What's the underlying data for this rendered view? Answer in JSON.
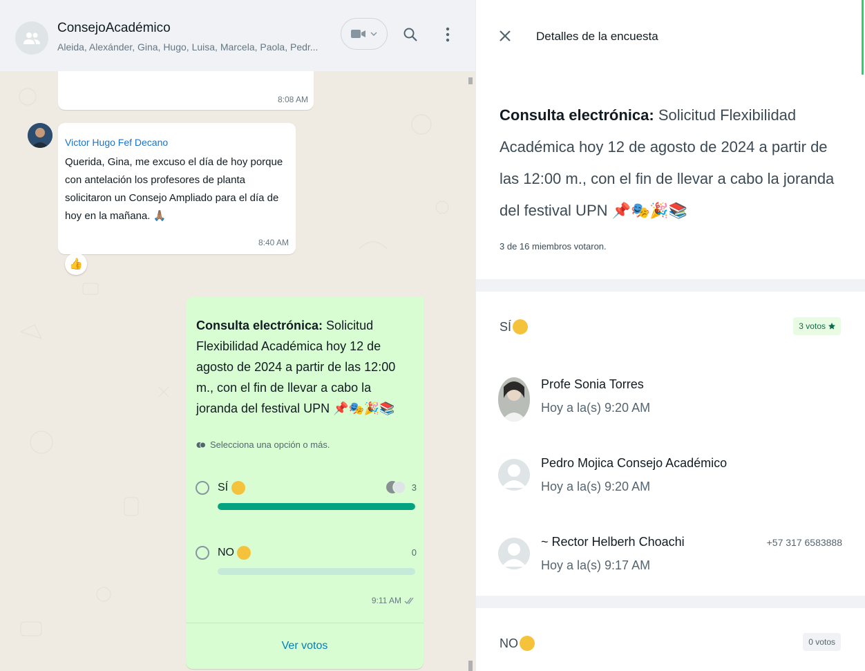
{
  "chat": {
    "header": {
      "group_name": "ConsejoAcadémico",
      "members": "Aleida, Alexánder, Gina, Hugo, Luisa, Marcela, Paola, Pedr..."
    },
    "prev_message": {
      "time": "8:08 AM"
    },
    "message": {
      "sender": "Victor Hugo Fef Decano",
      "text": "Querida, Gina, me excuso el día de hoy porque con antelación los profesores de planta solicitaron un Consejo Ampliado para el día de hoy en la mañana. 🙏🏽",
      "time": "8:40 AM",
      "reaction": "👍"
    },
    "poll": {
      "question_bold": "Consulta electrónica:",
      "question_rest": " Solicitud Flexibilidad Académica hoy 12 de agosto de 2024 a partir de las 12:00 m., con el fin de llevar a cabo la joranda del festival UPN 📌🎭🎉📚",
      "hint": "Selecciona una opción o más.",
      "options": [
        {
          "label": "SÍ",
          "count": "3",
          "fill": 1.0
        },
        {
          "label": "NO",
          "count": "0",
          "fill": 0.0
        }
      ],
      "time": "9:11 AM",
      "view_votes": "Ver votos"
    }
  },
  "details": {
    "title": "Detalles de la encuesta",
    "question_bold": "Consulta electrónica:",
    "question_rest": " Solicitud Flexibilidad Académica hoy 12 de agosto de 2024 a partir de las 12:00 m., con el fin de llevar a cabo la joranda del festival UPN 📌🎭🎉📚",
    "votes_summary": "3 de 16 miembros votaron.",
    "options": [
      {
        "label": "SÍ",
        "chip": "3 votos",
        "voters": [
          {
            "name": "Profe Sonia Torres",
            "time": "Hoy a la(s) 9:20 AM",
            "phone": ""
          },
          {
            "name": "Pedro Mojica Consejo Académico",
            "time": "Hoy a la(s) 9:20 AM",
            "phone": ""
          },
          {
            "name": "~ Rector Helberh Choachi",
            "time": "Hoy a la(s) 9:17 AM",
            "phone": "+57 317 6583888"
          }
        ]
      },
      {
        "label": "NO",
        "chip": "0 votos",
        "voters": []
      }
    ]
  },
  "colors": {
    "outgoing_bubble": "#d9fdd3",
    "bar_fill": "#03a37f",
    "accent": "#25d366",
    "link": "#027eb5"
  },
  "icons": [
    "group-avatar-icon",
    "video-call-icon",
    "search-icon",
    "menu-icon",
    "close-icon",
    "multi-select-icon",
    "double-check-icon",
    "star-icon",
    "user-avatar-icon"
  ]
}
